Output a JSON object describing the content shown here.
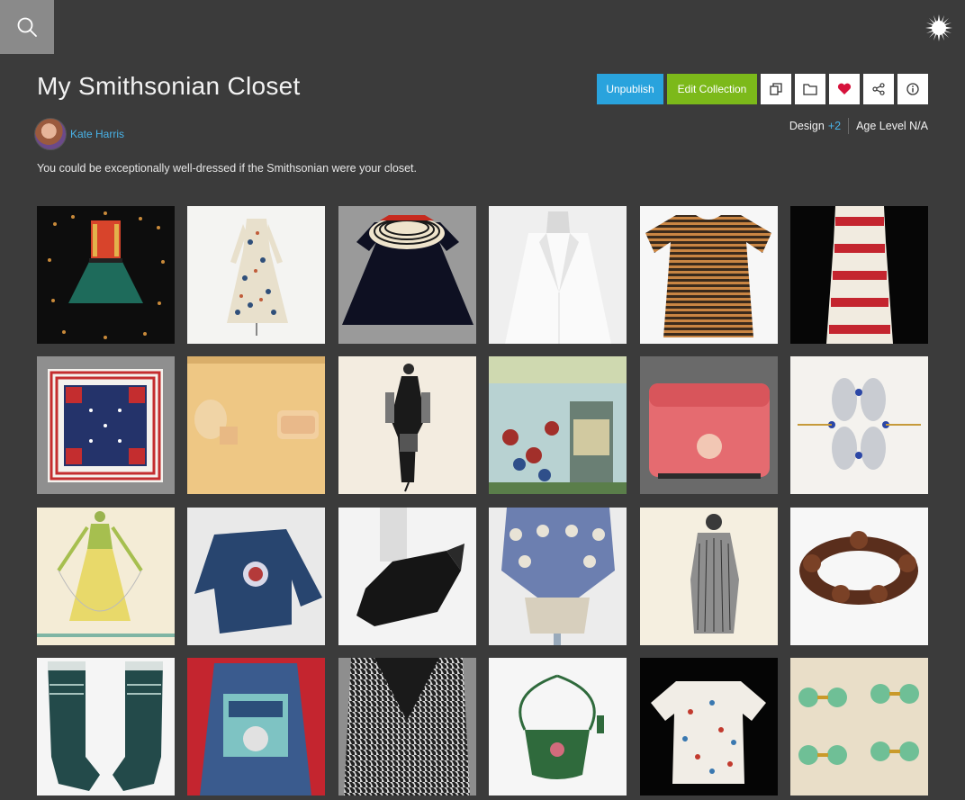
{
  "header": {
    "search_icon": "search-icon",
    "logo_icon": "smithsonian-sunburst-icon"
  },
  "collection": {
    "title": "My Smithsonian Closet",
    "author": "Kate Harris",
    "description": "You could be exceptionally well-dressed if the Smithsonian were your closet.",
    "subject": "Design",
    "subject_more": "+2",
    "age_level": "Age Level N/A"
  },
  "actions": {
    "unpublish_label": "Unpublish",
    "edit_label": "Edit Collection",
    "icons": [
      "copy-icon",
      "folder-icon",
      "heart-icon",
      "share-icon",
      "info-icon"
    ]
  },
  "colors": {
    "background": "#3b3b3b",
    "unpublish": "#29a3dd",
    "edit": "#7cb91a",
    "link": "#49b3e8",
    "heart": "#d6123c"
  },
  "items": [
    "red-green-dress",
    "floral-print-dress",
    "black-dress-striped-collar",
    "white-jacket",
    "striped-knit-dress",
    "soup-can-paper-dress",
    "patriotic-scarf",
    "hat-design-drawing",
    "fashion-sketch-black-coat",
    "vintage-trade-card",
    "queen-hair-dressing-tin",
    "silver-buckle-jewelry",
    "yellow-dress-illustration",
    "denim-jacket-patch",
    "black-feather-shoe",
    "ruffled-blue-garment",
    "coat-sketch",
    "tortoiseshell-bracelet",
    "knit-stockings",
    "painted-denim-jacket",
    "houndstooth-coat",
    "green-beaded-purse",
    "printed-shirt",
    "green-cufflinks"
  ]
}
